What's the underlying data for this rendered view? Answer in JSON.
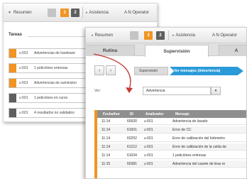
{
  "colors": {
    "accent_orange": "#f19422",
    "dark_gray": "#5e5e5e",
    "light_gray": "#a4a4a4",
    "breadcrumb_blue": "#2a9ad8",
    "arrow_red": "#c43a34",
    "header_gray": "#8f8f8f"
  },
  "back": {
    "topbar": {
      "resumen_label": "Resumen",
      "badge_orange": "3",
      "badge_gray": "2",
      "asistencia_label": "Asistencia",
      "operator_label": "A N Operator"
    },
    "tareas_title": "Tareas",
    "tasks": [
      {
        "code": "u 601",
        "desc": "Advertencias de hardware",
        "color": "orange"
      },
      {
        "code": "u 601",
        "desc": "1 peticiónes entresas",
        "color": "orange"
      },
      {
        "code": "u 601",
        "desc": "Advertencias de suministro",
        "color": "orange"
      },
      {
        "code": "u 601",
        "desc": "1 peticiónes en curso",
        "color": "gray"
      },
      {
        "code": "u 601",
        "desc": "4 resultados no validados",
        "color": "gray"
      }
    ]
  },
  "front": {
    "topbar": {
      "resumen_label": "Resumen",
      "badge_orange": "3",
      "badge_gray": "2",
      "asistencia_label": "Asistencia",
      "operator_label": "A N Operator"
    },
    "tabs": [
      "Rutina",
      "Supervisión",
      "A"
    ],
    "nav": {
      "back_icon": "‹",
      "forward_icon": "›"
    },
    "breadcrumbs": [
      "Supervisión",
      "Ver mensajes (Advertencia)"
    ],
    "filter": {
      "label": "Ver:",
      "value": "Advertencia",
      "dropdown_icon": "▼"
    },
    "table": {
      "headers": [
        "Fecha/hor",
        "ID",
        "Analizador",
        "Mensaje"
      ],
      "rows": [
        {
          "time": "11:14",
          "id": "60930",
          "analyzer": "u 601",
          "message": "Advertencia de lavado"
        },
        {
          "time": "11:14",
          "id": "61601",
          "analyzer": "u 601",
          "message": "Error de CC"
        },
        {
          "time": "11:14",
          "id": "60252",
          "analyzer": "u 601",
          "message": "Error de calibración del fotómetro"
        },
        {
          "time": "11:14",
          "id": "61212",
          "analyzer": "u 601",
          "message": "Error de calibración de la celda de"
        },
        {
          "time": "11:14",
          "id": "61634",
          "analyzer": "u 601",
          "message": "1 peticiónes entresas"
        },
        {
          "time": "11:15",
          "id": "60381",
          "analyzer": "u 601",
          "message": "Advertencia del casete de tiras re"
        }
      ]
    }
  }
}
